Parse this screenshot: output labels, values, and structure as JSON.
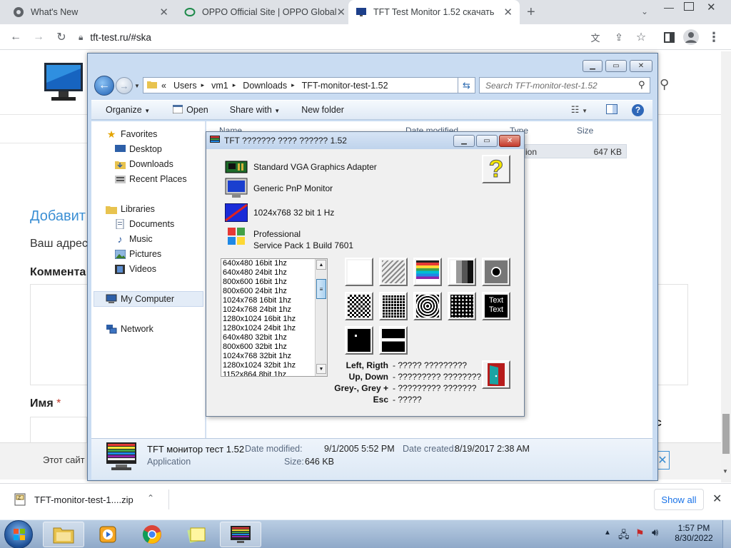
{
  "browser": {
    "tabs": [
      {
        "title": "What's New"
      },
      {
        "title": "OPPO Official Site | OPPO Global"
      },
      {
        "title": "TFT Test Monitor 1.52 скачать"
      }
    ],
    "url": "tft-test.ru/#ska"
  },
  "page": {
    "heading_add": "Добавит",
    "your_address": "Ваш адрес",
    "comment_label": "Коммента",
    "name_label": "Имя",
    "required_mark": "*",
    "site_notice": "Этот сайт"
  },
  "explorer": {
    "breadcrumb": [
      "«",
      "Users",
      "vm1",
      "Downloads",
      "TFT-monitor-test-1.52"
    ],
    "search_placeholder": "Search TFT-monitor-test-1.52",
    "commands": {
      "organize": "Organize",
      "open": "Open",
      "share": "Share with",
      "new_folder": "New folder"
    },
    "nav": {
      "favorites": "Favorites",
      "desktop": "Desktop",
      "downloads": "Downloads",
      "recent": "Recent Places",
      "libraries": "Libraries",
      "documents": "Documents",
      "music": "Music",
      "pictures": "Pictures",
      "videos": "Videos",
      "computer": "My Computer",
      "network": "Network"
    },
    "columns": {
      "name": "Name",
      "date": "Date modified",
      "type": "Type",
      "size": "Size"
    },
    "file_row": {
      "type": "ion",
      "size": "647 KB"
    },
    "details": {
      "name": "TFT монитор тест 1.52",
      "kind": "Application",
      "date_modified_label": "Date modified:",
      "date_modified": "9/1/2005 5:52 PM",
      "date_created_label": "Date created:",
      "date_created": "8/19/2017 2:38 AM",
      "size_label": "Size:",
      "size": "646 KB"
    }
  },
  "tft": {
    "title": "TFT ??????? ???? ?????? 1.52",
    "adapter": "Standard VGA Graphics Adapter",
    "monitor": "Generic PnP Monitor",
    "resolution": "1024x768 32 bit 1 Hz",
    "os_line1": "Professional",
    "os_line2": "Service Pack 1 Build 7601",
    "modes": [
      "640x480  16bit  1hz",
      "640x480  24bit  1hz",
      "800x600  16bit  1hz",
      "800x600  24bit  1hz",
      "1024x768  16bit  1hz",
      "1024x768  24bit  1hz",
      "1280x1024  16bit  1hz",
      "1280x1024  24bit  1hz",
      "640x480  32bit  1hz",
      "800x600  32bit  1hz",
      "1024x768  32bit  1hz",
      "1280x1024  32bit  1hz",
      "1152x864  8bit  1hz"
    ],
    "text_button_line1": "Text",
    "text_button_line2": "Text",
    "keys": [
      {
        "key": "Left, Rigth",
        "desc": "- ????? ?????????"
      },
      {
        "key": "Up, Down",
        "desc": "- ????????? ????????"
      },
      {
        "key": "Grey-, Grey +",
        "desc": "- ????????? ???????"
      },
      {
        "key": "Esc",
        "desc": "- ?????"
      }
    ],
    "help_icon": "question-mark-icon",
    "exit_icon": "exit-door-icon"
  },
  "downloads": {
    "file": "TFT-monitor-test-1....zip",
    "show_all": "Show all"
  },
  "taskbar": {
    "time": "1:57 PM",
    "date": "8/30/2022"
  },
  "colors": {
    "tab_bg": "#dee1e6",
    "link_blue": "#1a73e8",
    "heading_blue": "#3b8fd4",
    "titlebar": "#c9dcf2"
  }
}
